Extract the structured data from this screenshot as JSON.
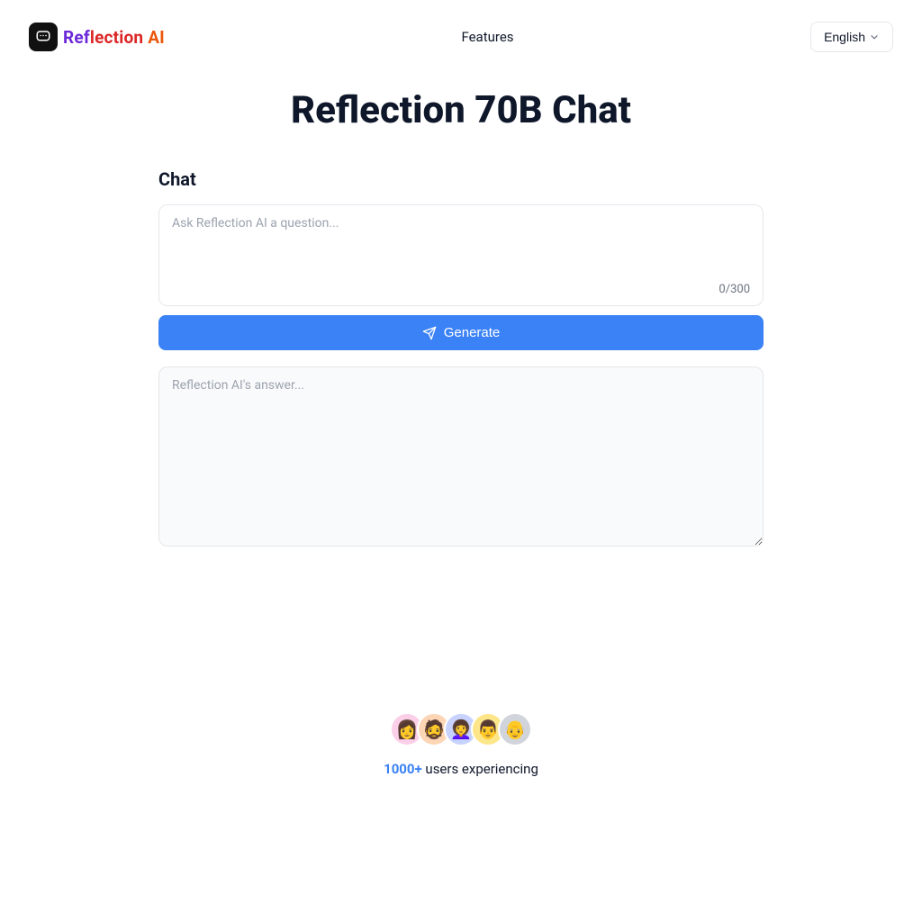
{
  "header": {
    "brand_name_seg1": "Ref",
    "brand_name_seg2": "lection ",
    "brand_name_seg3": "AI",
    "nav_features": "Features",
    "lang_label": "English"
  },
  "page": {
    "title": "Reflection 70B Chat"
  },
  "chat": {
    "section_label": "Chat",
    "input_placeholder": "Ask Reflection AI a question...",
    "char_count": "0/300",
    "generate_label": "Generate",
    "answer_placeholder": "Reflection AI's answer..."
  },
  "users": {
    "count_label": "1000+",
    "suffix": " users experiencing"
  }
}
